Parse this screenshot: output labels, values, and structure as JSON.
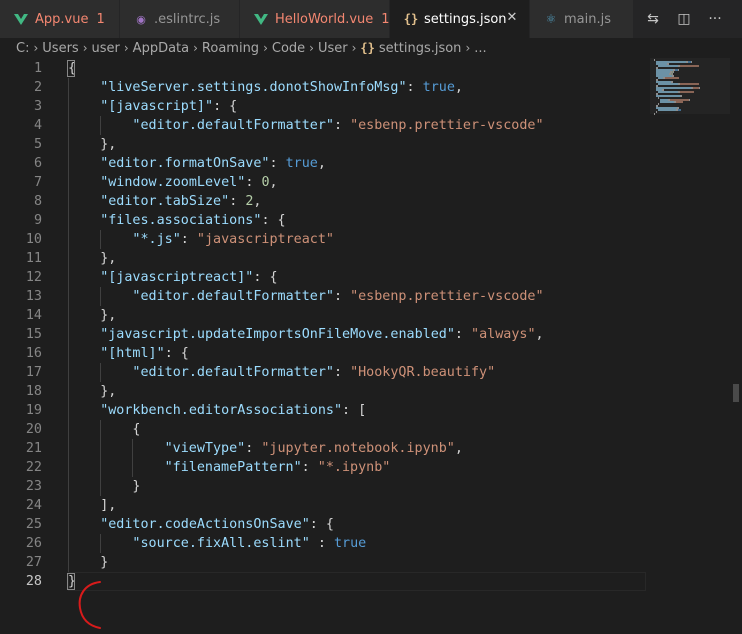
{
  "tabs": [
    {
      "label": "App.vue",
      "badge": "1",
      "icon": "vue-icon",
      "modified": true
    },
    {
      "label": ".eslintrc.js",
      "badge": "",
      "icon": "eslint-icon",
      "modified": false
    },
    {
      "label": "HelloWorld.vue",
      "badge": "1",
      "icon": "vue-icon",
      "modified": true
    },
    {
      "label": "settings.json",
      "badge": "",
      "icon": "json-braces-icon",
      "modified": false,
      "active": true
    },
    {
      "label": "main.js",
      "badge": "",
      "icon": "react-icon",
      "modified": false
    }
  ],
  "tab_icons": {
    "json": "{}",
    "eslint": "◉",
    "react": "⚛",
    "close": "✕"
  },
  "actions": [
    "compare-icon",
    "split-editor-icon",
    "more-actions-icon"
  ],
  "action_glyphs": {
    "compare": "⇆",
    "split": "◫",
    "more": "···"
  },
  "breadcrumb": [
    "C:",
    "Users",
    "user",
    "AppData",
    "Roaming",
    "Code",
    "User",
    "settings.json",
    "..."
  ],
  "breadcrumb_sep": "›",
  "colors": {
    "key": "#9cdcfe",
    "string": "#ce9178",
    "boolean": "#569cd6",
    "number": "#b5cea8",
    "punct": "#d4d4d4",
    "modified": "#f48771",
    "annotation": "#d81b1b"
  },
  "code_lines": [
    {
      "n": "1",
      "indent": 0,
      "t": [
        [
          "p",
          "{"
        ]
      ]
    },
    {
      "n": "2",
      "indent": 1,
      "t": [
        [
          "k",
          "\"liveServer.settings.donotShowInfoMsg\""
        ],
        [
          "p",
          ": "
        ],
        [
          "b",
          "true"
        ],
        [
          "p",
          ","
        ]
      ]
    },
    {
      "n": "3",
      "indent": 1,
      "t": [
        [
          "k",
          "\"[javascript]\""
        ],
        [
          "p",
          ": {"
        ]
      ]
    },
    {
      "n": "4",
      "indent": 2,
      "t": [
        [
          "k",
          "\"editor.defaultFormatter\""
        ],
        [
          "p",
          ": "
        ],
        [
          "s",
          "\"esbenp.prettier-vscode\""
        ]
      ]
    },
    {
      "n": "5",
      "indent": 1,
      "t": [
        [
          "p",
          "},"
        ]
      ]
    },
    {
      "n": "6",
      "indent": 1,
      "t": [
        [
          "k",
          "\"editor.formatOnSave\""
        ],
        [
          "p",
          ": "
        ],
        [
          "b",
          "true"
        ],
        [
          "p",
          ","
        ]
      ]
    },
    {
      "n": "7",
      "indent": 1,
      "t": [
        [
          "k",
          "\"window.zoomLevel\""
        ],
        [
          "p",
          ": "
        ],
        [
          "n",
          "0"
        ],
        [
          "p",
          ","
        ]
      ]
    },
    {
      "n": "8",
      "indent": 1,
      "t": [
        [
          "k",
          "\"editor.tabSize\""
        ],
        [
          "p",
          ": "
        ],
        [
          "n",
          "2"
        ],
        [
          "p",
          ","
        ]
      ]
    },
    {
      "n": "9",
      "indent": 1,
      "t": [
        [
          "k",
          "\"files.associations\""
        ],
        [
          "p",
          ": {"
        ]
      ]
    },
    {
      "n": "10",
      "indent": 2,
      "t": [
        [
          "k",
          "\"*.js\""
        ],
        [
          "p",
          ": "
        ],
        [
          "s",
          "\"javascriptreact\""
        ]
      ]
    },
    {
      "n": "11",
      "indent": 1,
      "t": [
        [
          "p",
          "},"
        ]
      ]
    },
    {
      "n": "12",
      "indent": 1,
      "t": [
        [
          "k",
          "\"[javascriptreact]\""
        ],
        [
          "p",
          ": {"
        ]
      ]
    },
    {
      "n": "13",
      "indent": 2,
      "t": [
        [
          "k",
          "\"editor.defaultFormatter\""
        ],
        [
          "p",
          ": "
        ],
        [
          "s",
          "\"esbenp.prettier-vscode\""
        ]
      ]
    },
    {
      "n": "14",
      "indent": 1,
      "t": [
        [
          "p",
          "},"
        ]
      ]
    },
    {
      "n": "15",
      "indent": 1,
      "t": [
        [
          "k",
          "\"javascript.updateImportsOnFileMove.enabled\""
        ],
        [
          "p",
          ": "
        ],
        [
          "s",
          "\"always\""
        ],
        [
          "p",
          ","
        ]
      ]
    },
    {
      "n": "16",
      "indent": 1,
      "t": [
        [
          "k",
          "\"[html]\""
        ],
        [
          "p",
          ": {"
        ]
      ]
    },
    {
      "n": "17",
      "indent": 2,
      "t": [
        [
          "k",
          "\"editor.defaultFormatter\""
        ],
        [
          "p",
          ": "
        ],
        [
          "s",
          "\"HookyQR.beautify\""
        ]
      ]
    },
    {
      "n": "18",
      "indent": 1,
      "t": [
        [
          "p",
          "},"
        ]
      ]
    },
    {
      "n": "19",
      "indent": 1,
      "t": [
        [
          "k",
          "\"workbench.editorAssociations\""
        ],
        [
          "p",
          ": ["
        ]
      ]
    },
    {
      "n": "20",
      "indent": 2,
      "t": [
        [
          "p",
          "{"
        ]
      ]
    },
    {
      "n": "21",
      "indent": 3,
      "t": [
        [
          "k",
          "\"viewType\""
        ],
        [
          "p",
          ": "
        ],
        [
          "s",
          "\"jupyter.notebook.ipynb\""
        ],
        [
          "p",
          ","
        ]
      ]
    },
    {
      "n": "22",
      "indent": 3,
      "t": [
        [
          "k",
          "\"filenamePattern\""
        ],
        [
          "p",
          ": "
        ],
        [
          "s",
          "\"*.ipynb\""
        ]
      ]
    },
    {
      "n": "23",
      "indent": 2,
      "t": [
        [
          "p",
          "}"
        ]
      ]
    },
    {
      "n": "24",
      "indent": 1,
      "t": [
        [
          "p",
          "],"
        ]
      ]
    },
    {
      "n": "25",
      "indent": 1,
      "t": [
        [
          "k",
          "\"editor.codeActionsOnSave\""
        ],
        [
          "p",
          ": {"
        ]
      ]
    },
    {
      "n": "26",
      "indent": 2,
      "t": [
        [
          "k",
          "\"source.fixAll.eslint\""
        ],
        [
          "p",
          " : "
        ],
        [
          "b",
          "true"
        ]
      ]
    },
    {
      "n": "27",
      "indent": 1,
      "t": [
        [
          "p",
          "}"
        ]
      ]
    },
    {
      "n": "28",
      "indent": 0,
      "t": [
        [
          "p",
          "}"
        ]
      ]
    }
  ],
  "current_line": "28"
}
